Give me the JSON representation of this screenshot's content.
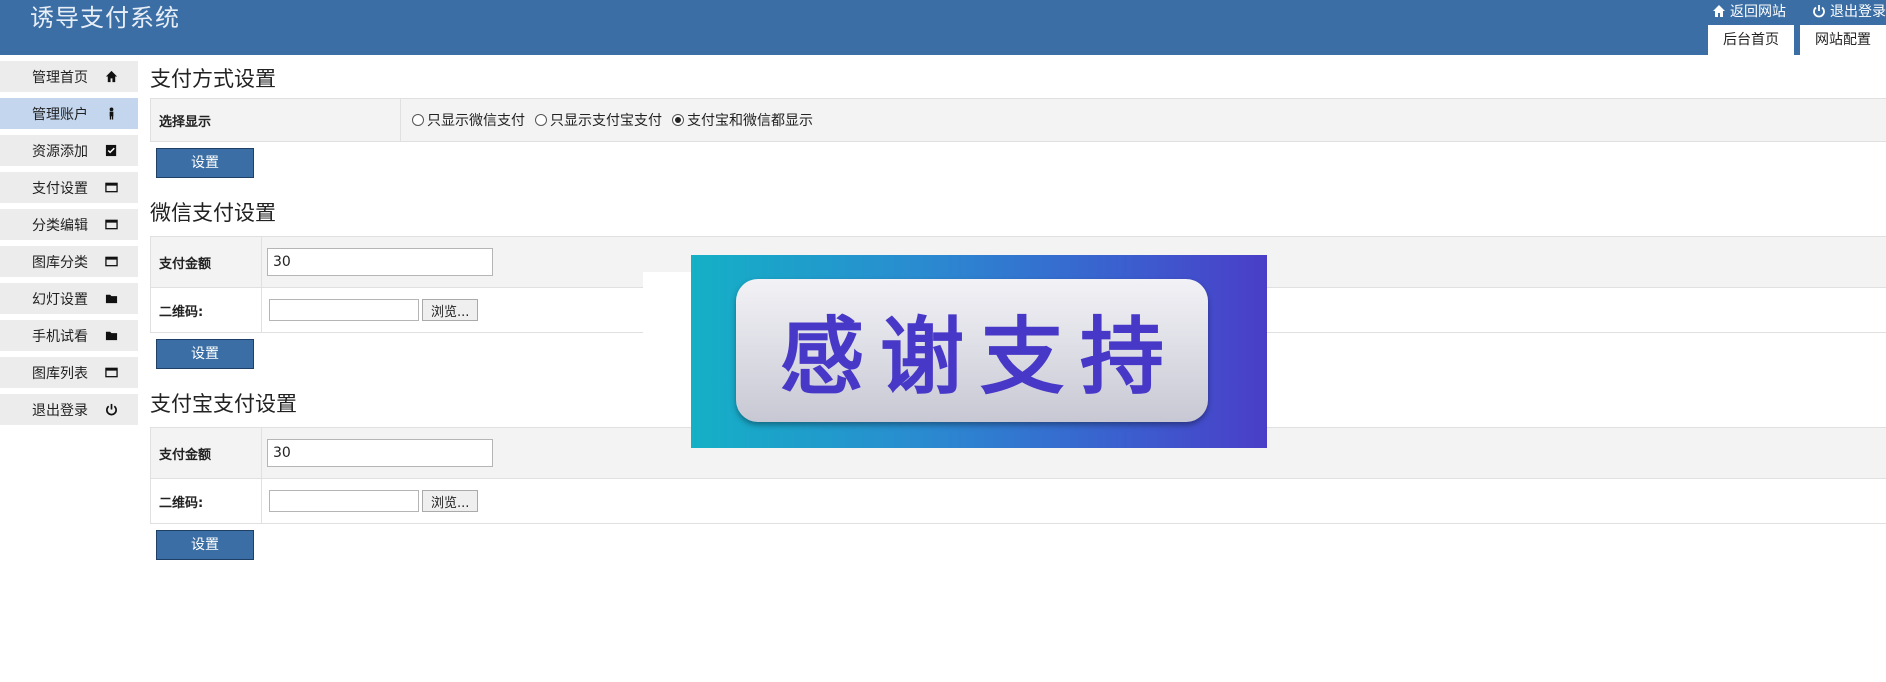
{
  "header": {
    "title": "诱导支付系统",
    "links": [
      {
        "label": "返回网站",
        "icon": "home-icon"
      },
      {
        "label": "退出登录",
        "icon": "power-icon"
      }
    ],
    "tabs": [
      "后台首页",
      "网站配置"
    ]
  },
  "sidebar": {
    "items": [
      {
        "label": "管理首页",
        "icon": "home-icon"
      },
      {
        "label": "管理账户",
        "icon": "user-icon"
      },
      {
        "label": "资源添加",
        "icon": "document-edit-icon"
      },
      {
        "label": "支付设置",
        "icon": "window-icon"
      },
      {
        "label": "分类编辑",
        "icon": "window-icon"
      },
      {
        "label": "图库分类",
        "icon": "window-icon"
      },
      {
        "label": "幻灯设置",
        "icon": "folder-icon"
      },
      {
        "label": "手机试看",
        "icon": "folder-icon"
      },
      {
        "label": "图库列表",
        "icon": "window-icon"
      },
      {
        "label": "退出登录",
        "icon": "power-icon"
      }
    ],
    "active_index": 1
  },
  "payment_method": {
    "title": "支付方式设置",
    "label": "选择显示",
    "options": [
      "只显示微信支付",
      "只显示支付宝支付",
      "支付宝和微信都显示"
    ],
    "selected_index": 2,
    "submit_label": "设置"
  },
  "wechat": {
    "title": "微信支付设置",
    "amount_label": "支付金额",
    "amount_value": "30",
    "qr_label": "二维码:",
    "browse_label": "浏览...",
    "submit_label": "设置"
  },
  "alipay": {
    "title": "支付宝支付设置",
    "amount_label": "支付金额",
    "amount_value": "30",
    "qr_label": "二维码:",
    "browse_label": "浏览...",
    "submit_label": "设置"
  },
  "banner": {
    "text": "感谢支持"
  },
  "colors": {
    "header_bg": "#3a6ea5",
    "active_sidebar": "#c3d6ee",
    "banner_text": "#4838c7"
  }
}
